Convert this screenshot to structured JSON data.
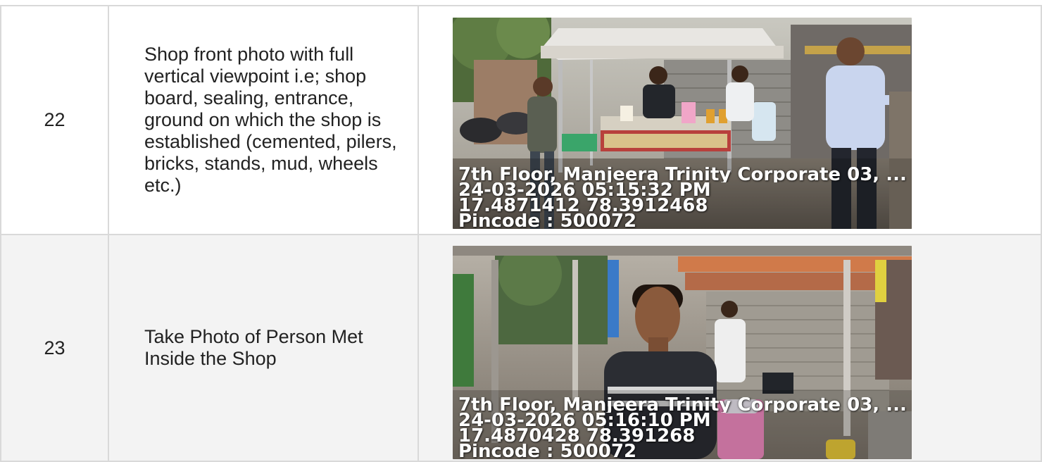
{
  "rows": [
    {
      "number": "22",
      "description": "Shop front photo with full vertical viewpoint i.e; shop board, sealing, entrance, ground on which the shop is established (cemented, pilers, bricks, stands, mud, wheels etc.)",
      "stamp": {
        "address": "7th Floor, Manjeera Trinity Corporate 03, ...",
        "datetime": "24-03-2026 05:15:32 PM",
        "coordinates": "17.4871412 78.3912468",
        "pincode": "Pincode : 500072"
      }
    },
    {
      "number": "23",
      "description": "Take Photo of Person Met Inside the Shop",
      "stamp": {
        "address": "7th Floor, Manjeera Trinity Corporate 03, ...",
        "datetime": "24-03-2026 05:16:10 PM",
        "coordinates": "17.4870428 78.391268",
        "pincode": "Pincode : 500072"
      }
    }
  ]
}
